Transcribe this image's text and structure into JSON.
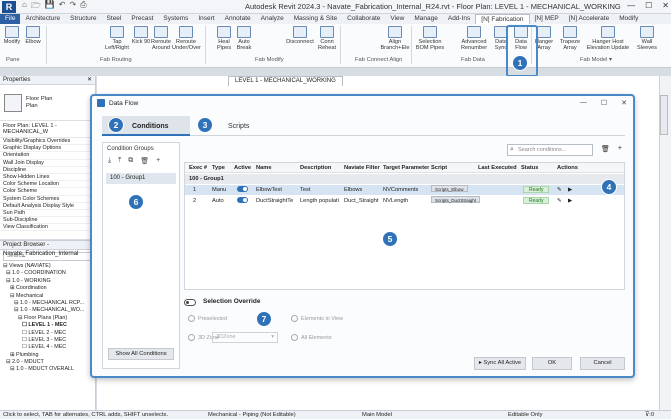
{
  "window": {
    "app_letter": "R",
    "title": "Autodesk Revit 2024.3 - Navate_Fabrication_Internal_R24.rvt - Floor Plan: LEVEL 1 - MECHANICAL_WORKING",
    "quick_access": [
      "⌂",
      "🗁",
      "💾",
      "↶",
      "↷",
      "⎙"
    ]
  },
  "ribbon_tabs": [
    "File",
    "Architecture",
    "Structure",
    "Steel",
    "Precast",
    "Systems",
    "Insert",
    "Annotate",
    "Analyze",
    "Massing & Site",
    "Collaborate",
    "View",
    "Manage",
    "Add-Ins",
    "[N] Fabrication",
    "[N] MEP",
    "[N] Accelerate",
    "Modify"
  ],
  "ribbon": {
    "buttons": [
      {
        "label": "Modify",
        "icon": "modify-icon"
      },
      {
        "label": "Elbow",
        "icon": "elbow-icon"
      },
      {
        "label": "Tap Left/Right",
        "icon": "tap-icon"
      },
      {
        "label": "Kick 90",
        "icon": "kick-icon"
      },
      {
        "label": "Reroute Around",
        "icon": "reroute-icon"
      },
      {
        "label": "Reroute Under/Over",
        "icon": "reroute-under-icon"
      },
      {
        "label": "Heal Pipes",
        "icon": "heal-icon"
      },
      {
        "label": "Auto Break",
        "icon": "break-icon"
      },
      {
        "label": "Disconnect",
        "icon": "disconnect-icon"
      },
      {
        "label": "Conn Reheat",
        "icon": "connect-icon"
      },
      {
        "label": "Align Branch+Ele",
        "icon": "align-icon"
      },
      {
        "label": "Selection BOM Pipes",
        "icon": "bom-icon"
      },
      {
        "label": "Advanced Renumber",
        "icon": "renumber-icon"
      },
      {
        "label": "Data Sync",
        "icon": "sync-icon"
      },
      {
        "label": "Data Flow",
        "icon": "dataflow-icon"
      },
      {
        "label": "Hanger Array",
        "icon": "hanger-icon"
      },
      {
        "label": "Trapeze Array",
        "icon": "trapeze-icon"
      },
      {
        "label": "Hanger Host Elevation Update",
        "icon": "host-icon"
      },
      {
        "label": "Wall Sleeves",
        "icon": "sleeve-icon"
      }
    ],
    "groups": [
      "Fab Routing",
      "Fab Modify",
      "Fab Connect Align",
      "Fab Data",
      "Fab Model ▾"
    ],
    "select_label": "Pane"
  },
  "properties": {
    "header": "Properties",
    "type_line1": "Floor Plan",
    "type_line2": "Plan",
    "selector": "Floor Plan: LEVEL 1 - MECHANICAL_W",
    "rows": [
      "Visibility/Graphics Overrides",
      "Graphic Display Options",
      "Orientation",
      "Wall Join Display",
      "Discipline",
      "Show Hidden Lines",
      "Color Scheme Location",
      "Color Scheme",
      "System Color Schemes",
      "Default Analysis Display Style",
      "Sun Path",
      "Sub-Discipline",
      "View Classification"
    ]
  },
  "browser": {
    "header": "Project Browser - Navate_Fabrication_Internal",
    "search_placeholder": "Search",
    "tree": [
      "⊟ Views (NAVIATE)",
      "  ⊟ 1.0 - COORDINATION",
      "  ⊟ 1.0 - WORKING",
      "    ⊞ Coordination",
      "    ⊟ Mechanical",
      "      ⊟ 1.0 - MECHANICAL RCP...",
      "      ⊟ 1.0 - MECHANICAL_WO...",
      "        ⊟ Floor Plans (Plan)",
      "          ☐ LEVEL 1 - MEC",
      "          ☐ LEVEL 2 - MEC",
      "          ☐ LEVEL 3 - MEC",
      "          ☐ LEVEL 4 - MEC",
      "    ⊞ Plumbing",
      "  ⊟ 2.0 - MDUCT",
      "    ⊟ 1.0 - MDUCT OVERALL"
    ]
  },
  "view_tab": "LEVEL 1 - MECHANICAL_WORKING",
  "status": {
    "left": "Click to select, TAB for alternates, CTRL adds, SHIFT unselects.",
    "workset": "Mechanical - Piping (Not Editable)",
    "model": "Main Model",
    "editable": "Editable Only",
    "filter": "⊽:0"
  },
  "dialog": {
    "title": "Data Flow",
    "tabs": [
      "Conditions",
      "Scripts"
    ],
    "condition_groups": {
      "header": "Condition Groups",
      "tools": [
        "⤓",
        "⤒",
        "⧉",
        "🗑",
        "+"
      ],
      "items": [
        "100 - Group1"
      ],
      "show_all": "Show All Conditions"
    },
    "search_placeholder": "Search conditions...",
    "table_tools": [
      "🗑",
      "+"
    ],
    "columns": [
      "Exec #",
      "Type",
      "Active",
      "Name",
      "Description",
      "Naviate Filter",
      "Target Parameter",
      "Script",
      "Last Executed",
      "Status",
      "Actions"
    ],
    "section": "100 - Group1",
    "rows": [
      {
        "exec": "1",
        "type": "Manu",
        "name": "ElbowTest",
        "description": "Test",
        "filter": "Elbows",
        "target": "NVComments",
        "script": "Scripts_Elbow",
        "last": "",
        "status": "Ready"
      },
      {
        "exec": "2",
        "type": "Auto",
        "name": "DuctStraightTe",
        "description": "Length populati",
        "filter": "Duct_Straight",
        "target": "NVLength",
        "script": "Scripts_DuctStraight",
        "last": "",
        "status": "Ready"
      }
    ],
    "selection_override": {
      "title": "Selection Override",
      "options": [
        "Preselected",
        "Elements in View",
        "3D Zone",
        "All Elements"
      ],
      "zone_value": "3DZone"
    },
    "buttons": {
      "sync": "▸ Sync All Active",
      "ok": "OK",
      "cancel": "Cancel"
    }
  },
  "badges": [
    "1",
    "2",
    "3",
    "4",
    "5",
    "6",
    "7"
  ]
}
